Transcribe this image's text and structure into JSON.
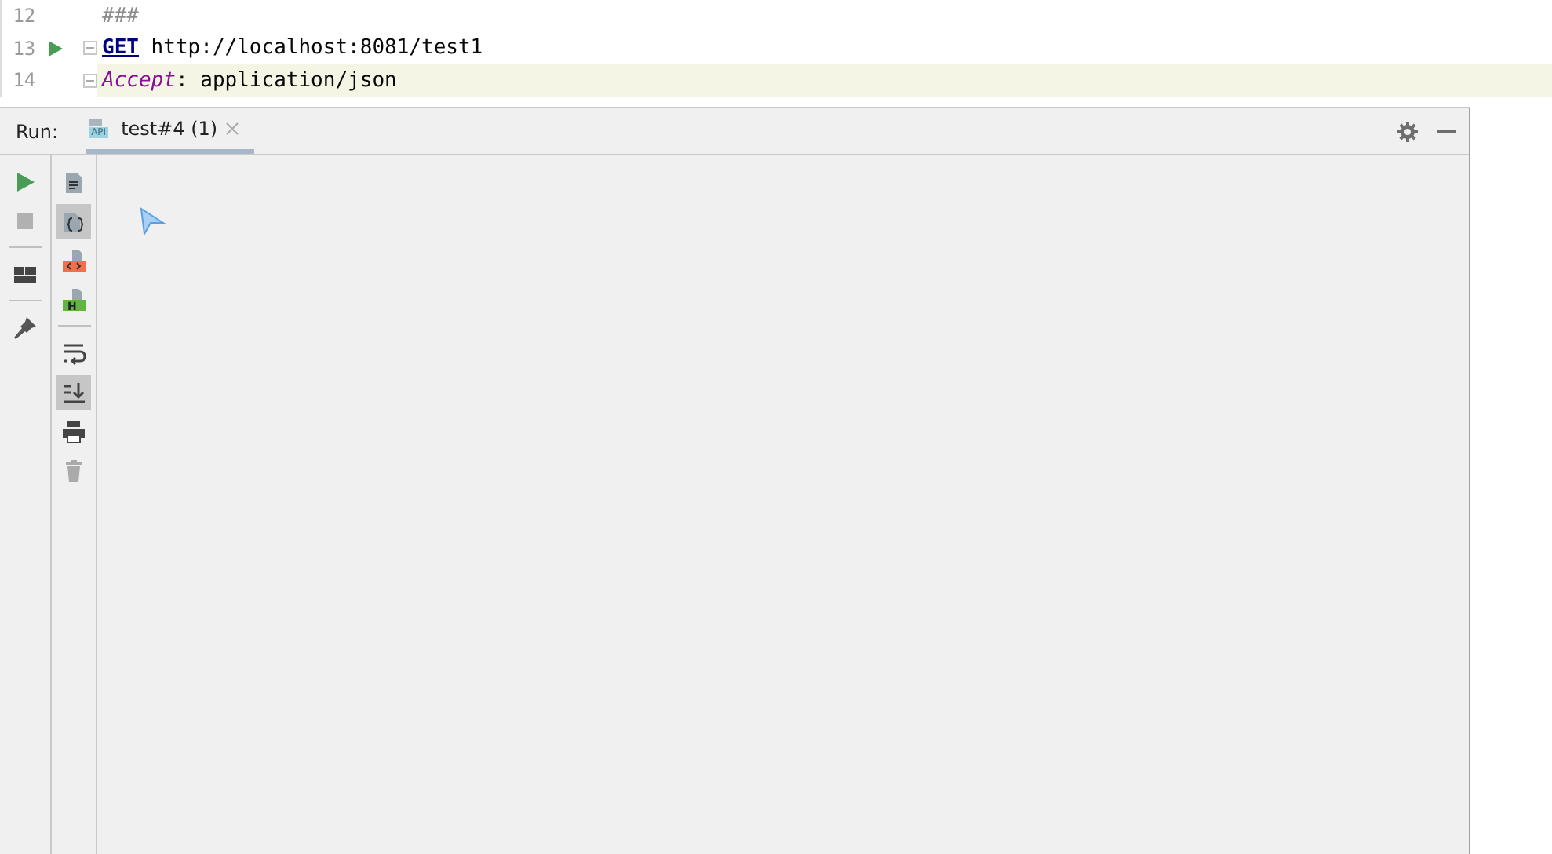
{
  "editor": {
    "lines": [
      {
        "number": "12",
        "run_button": false,
        "fold": false,
        "current": false,
        "tokens": [
          {
            "kind": "comment",
            "text": "###"
          }
        ]
      },
      {
        "number": "13",
        "run_button": true,
        "fold": true,
        "current": false,
        "tokens": [
          {
            "kind": "method",
            "text": "GET"
          },
          {
            "kind": "plain",
            "text": " http://localhost:8081/test1"
          }
        ]
      },
      {
        "number": "14",
        "run_button": false,
        "fold": true,
        "current": true,
        "tokens": [
          {
            "kind": "header",
            "text": "Accept"
          },
          {
            "kind": "plain",
            "text": ": application/json"
          }
        ]
      }
    ]
  },
  "run_panel": {
    "label": "Run:",
    "tabs": [
      {
        "label": "test#4 (1)",
        "icon_text": "API",
        "selected": true
      }
    ],
    "left_toolbar": [
      {
        "kind": "run",
        "disabled": false
      },
      {
        "kind": "stop",
        "disabled": true
      },
      {
        "kind": "separator"
      },
      {
        "kind": "layout",
        "disabled": false
      },
      {
        "kind": "separator"
      },
      {
        "kind": "pin",
        "disabled": false
      }
    ],
    "output_toolbar": [
      {
        "kind": "text",
        "selected": false
      },
      {
        "kind": "json",
        "selected": true
      },
      {
        "kind": "html",
        "selected": false
      },
      {
        "kind": "header",
        "badge": "H",
        "selected": false
      },
      {
        "kind": "separator"
      },
      {
        "kind": "wrap",
        "selected": false
      },
      {
        "kind": "scroll-end",
        "selected": true
      },
      {
        "kind": "print",
        "selected": false
      },
      {
        "kind": "delete",
        "selected": false
      }
    ]
  }
}
